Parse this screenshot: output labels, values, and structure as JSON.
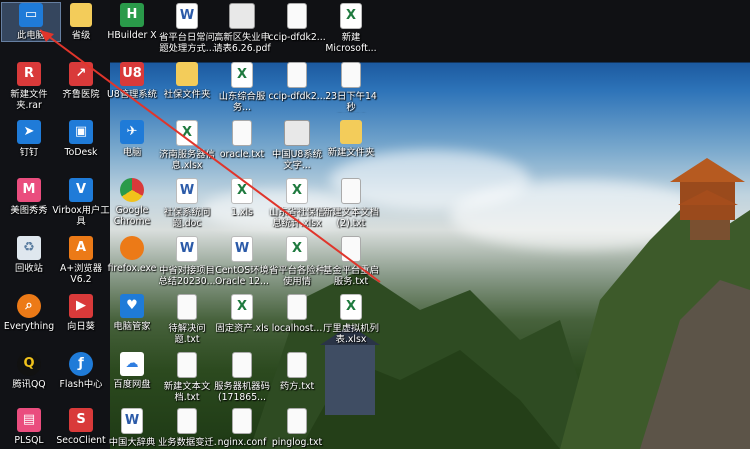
{
  "accent_colors": {
    "arrow": "#e0352b",
    "selection": "#6aa0e0"
  },
  "icons": [
    {
      "label": "此电脑",
      "icon": "computer-icon"
    },
    {
      "label": "省级",
      "icon": "folder-icon"
    },
    {
      "label": "HBuilder X",
      "icon": "hbuilder-icon"
    },
    {
      "label": "省平台日常问题处理方式...",
      "icon": "word-icon"
    },
    {
      "label": "高新区失业申请表6.26.pdf",
      "icon": "pdf-icon"
    },
    {
      "label": "ccip-dfdk2...",
      "icon": "text-file-icon"
    },
    {
      "label": "新建 Microsoft...",
      "icon": "excel-icon"
    },
    {
      "label": "新建文件夹.rar",
      "icon": "rar-icon"
    },
    {
      "label": "齐鲁医院",
      "icon": "shortcut-icon"
    },
    {
      "label": "U8管理系统",
      "icon": "app-icon"
    },
    {
      "label": "社保文件夹",
      "icon": "folder-icon"
    },
    {
      "label": "山东综合服务...",
      "icon": "excel-icon"
    },
    {
      "label": "ccip-dfdk2...",
      "icon": "text-file-icon"
    },
    {
      "label": "23日下午14秒_p70799...",
      "icon": "text-file-icon"
    },
    {
      "label": "钉钉",
      "icon": "dingtalk-icon"
    },
    {
      "label": "ToDesk",
      "icon": "todesk-icon"
    },
    {
      "label": "电脑",
      "icon": "app-icon"
    },
    {
      "label": "济南服务器信息.xlsx",
      "icon": "excel-icon"
    },
    {
      "label": "oracle.txt",
      "icon": "text-file-icon"
    },
    {
      "label": "中国U8系统文字...",
      "icon": "image-icon"
    },
    {
      "label": "新建文件夹",
      "icon": "folder-icon"
    },
    {
      "label": "美图秀秀",
      "icon": "meitu-icon"
    },
    {
      "label": "Virbox用户工具",
      "icon": "virbox-icon"
    },
    {
      "label": "Google Chrome",
      "icon": "chrome-icon"
    },
    {
      "label": "社保系统问题.doc",
      "icon": "word-icon"
    },
    {
      "label": "1.xls",
      "icon": "excel-icon"
    },
    {
      "label": "山东省社保信息统计.xlsx",
      "icon": "excel-icon"
    },
    {
      "label": "新建文本文档(2).txt",
      "icon": "text-file-icon"
    },
    {
      "label": "回收站",
      "icon": "recycle-bin-icon"
    },
    {
      "label": "A+浏览器 V6.2",
      "icon": "browser-icon"
    },
    {
      "label": "firefox.exe",
      "icon": "firefox-icon"
    },
    {
      "label": "中省对接项目总结20230...",
      "icon": "word-icon"
    },
    {
      "label": "CentOS环境Oracle 12...",
      "icon": "word-icon"
    },
    {
      "label": "省平台各险种使用情况.xlsx",
      "icon": "excel-icon"
    },
    {
      "label": "基金平台重启服务.txt",
      "icon": "text-file-icon"
    },
    {
      "label": "Everything",
      "icon": "everything-icon"
    },
    {
      "label": "向日葵",
      "icon": "sunflower-icon"
    },
    {
      "label": "电脑管家",
      "icon": "pc-manager-icon"
    },
    {
      "label": "待解决问题.txt",
      "icon": "text-file-icon"
    },
    {
      "label": "固定资产.xls",
      "icon": "excel-icon"
    },
    {
      "label": "localhost...",
      "icon": "text-file-icon"
    },
    {
      "label": "厅里虚拟机列表.xlsx",
      "icon": "excel-icon"
    },
    {
      "label": "腾讯QQ",
      "icon": "qq-icon"
    },
    {
      "label": "Flash中心",
      "icon": "flash-icon"
    },
    {
      "label": "百度网盘",
      "icon": "baidu-pan-icon"
    },
    {
      "label": "新建文本文档.txt",
      "icon": "text-file-icon"
    },
    {
      "label": "服务器机器码(171865...",
      "icon": "text-file-icon"
    },
    {
      "label": "药方.txt",
      "icon": "text-file-icon"
    },
    {
      "label": "PLSQL",
      "icon": "plsql-icon"
    },
    {
      "label": "SecoClient",
      "icon": "secoclient-icon"
    },
    {
      "label": "中国大辞典",
      "icon": "word-icon"
    },
    {
      "label": "业务数据变迁...",
      "icon": "text-file-icon"
    },
    {
      "label": "nginx.conf",
      "icon": "text-file-icon"
    },
    {
      "label": "pinglog.txt",
      "icon": "text-file-icon"
    }
  ]
}
